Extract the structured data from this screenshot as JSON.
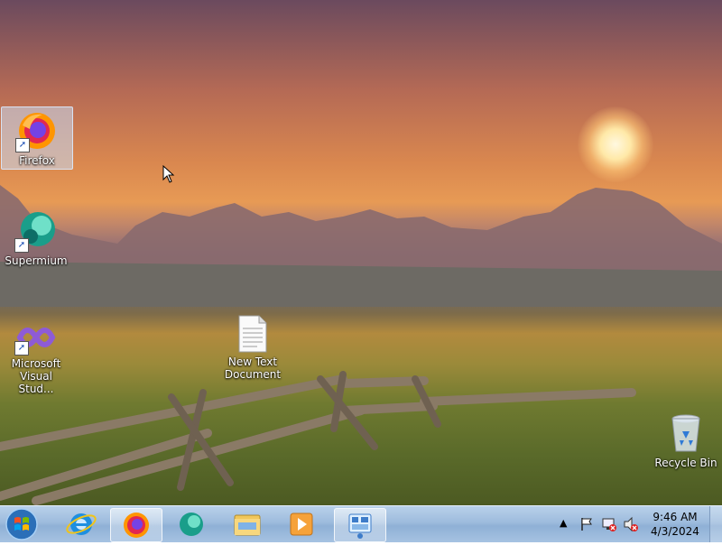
{
  "desktop": {
    "icons": [
      {
        "label": "Firefox"
      },
      {
        "label": "Supermium"
      },
      {
        "label": "Microsoft Visual Stud..."
      },
      {
        "label": "New Text Document"
      },
      {
        "label": "Recycle Bin"
      }
    ]
  },
  "taskbar": {
    "clock_time": "9:46 AM",
    "clock_date": "4/3/2024"
  },
  "colors": {
    "taskbar": "#a6c2e2",
    "selection": "#c8dcf5"
  }
}
